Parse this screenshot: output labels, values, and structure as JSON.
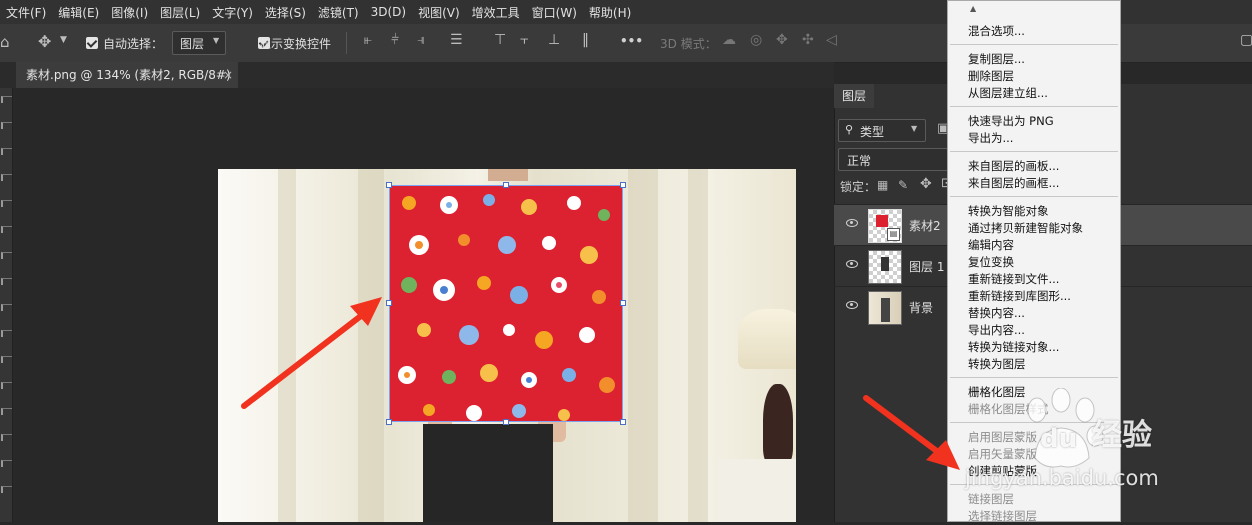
{
  "menubar": {
    "items": [
      "文件(F)",
      "编辑(E)",
      "图像(I)",
      "图层(L)",
      "文字(Y)",
      "选择(S)",
      "滤镜(T)",
      "3D(D)",
      "视图(V)",
      "增效工具",
      "窗口(W)",
      "帮助(H)"
    ]
  },
  "options": {
    "auto_select_label": "自动选择：",
    "auto_select_value": "图层",
    "show_transform_label": "显示变换控件",
    "more": "•••",
    "mode_3d_label": "3D 模式："
  },
  "document": {
    "tab_title": "素材.png @ 134% (素材2, RGB/8#) *",
    "close": "×"
  },
  "layers_panel": {
    "tab": "图层",
    "filter_label": "类型",
    "blend_mode": "正常",
    "lock_label": "锁定：",
    "layers": [
      {
        "name": "素材2",
        "selected": true
      },
      {
        "name": "图层 1",
        "selected": false
      },
      {
        "name": "背景",
        "selected": false
      }
    ]
  },
  "context_menu": {
    "top_arrow": "▲",
    "groups": [
      [
        "混合选项..."
      ],
      [
        "复制图层...",
        "删除图层",
        "从图层建立组..."
      ],
      [
        "快速导出为 PNG",
        "导出为..."
      ],
      [
        "来自图层的画板...",
        "来自图层的画框..."
      ],
      [
        "转换为智能对象",
        "通过拷贝新建智能对象",
        "编辑内容",
        "复位变换",
        "重新链接到文件...",
        "重新链接到库图形...",
        "替换内容...",
        "导出内容...",
        "转换为链接对象...",
        "转换为图层"
      ],
      [
        "栅格化图层",
        "栅格化图层样式"
      ],
      [
        "启用图层蒙版",
        "启用矢量蒙版",
        "创建剪贴蒙版"
      ],
      [
        "链接图层",
        "选择链接图层"
      ]
    ],
    "disabled": [
      "栅格化图层样式",
      "启用图层蒙版",
      "启用矢量蒙版",
      "链接图层",
      "选择链接图层"
    ]
  },
  "watermark": {
    "brand_du": "du",
    "brand_text": "经验",
    "url": "jingyan.baidu.com"
  },
  "colors": {
    "arrow": "#f0321e",
    "pattern_red": "#dc2130",
    "selection_blue": "#7ea1f2",
    "menu_bg": "#f3f3f3",
    "panel_bg": "#323232"
  }
}
